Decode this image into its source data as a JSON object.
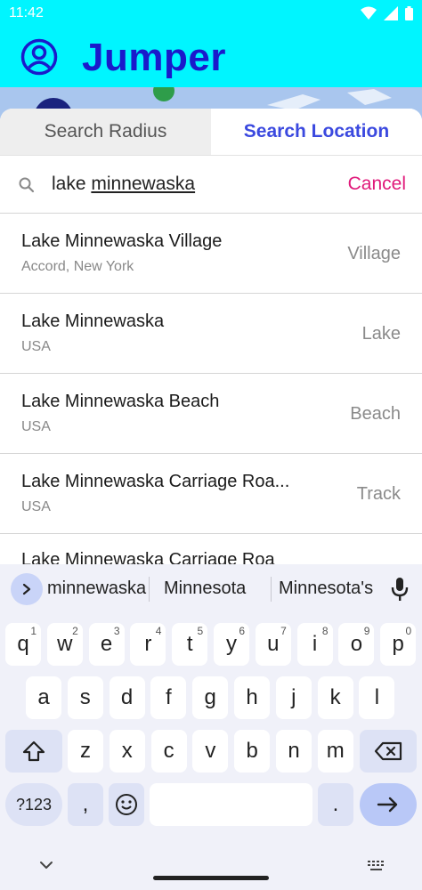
{
  "status": {
    "time": "11:42"
  },
  "app": {
    "title": "Jumper",
    "color_primary": "#00f5ff",
    "color_title": "#1a1acb"
  },
  "tabs": [
    {
      "label": "Search Radius",
      "active": false
    },
    {
      "label": "Search Location",
      "active": true
    }
  ],
  "search": {
    "prefix": "lake ",
    "underlined": "minnewaska",
    "cancel_label": "Cancel"
  },
  "results": [
    {
      "name": "Lake Minnewaska Village",
      "subtitle": "Accord, New York",
      "type": "Village"
    },
    {
      "name": "Lake Minnewaska",
      "subtitle": "USA",
      "type": "Lake"
    },
    {
      "name": "Lake Minnewaska Beach",
      "subtitle": "USA",
      "type": "Beach"
    },
    {
      "name": "Lake Minnewaska Carriage Roa...",
      "subtitle": "USA",
      "type": "Track"
    },
    {
      "name": "Lake Minnewaska Carriage Roa",
      "subtitle": "",
      "type": ""
    }
  ],
  "keyboard": {
    "suggestions": [
      "minnewaska",
      "Minnesota",
      "Minnesota's"
    ],
    "row1": [
      {
        "k": "q",
        "h": "1"
      },
      {
        "k": "w",
        "h": "2"
      },
      {
        "k": "e",
        "h": "3"
      },
      {
        "k": "r",
        "h": "4"
      },
      {
        "k": "t",
        "h": "5"
      },
      {
        "k": "y",
        "h": "6"
      },
      {
        "k": "u",
        "h": "7"
      },
      {
        "k": "i",
        "h": "8"
      },
      {
        "k": "o",
        "h": "9"
      },
      {
        "k": "p",
        "h": "0"
      }
    ],
    "row2": [
      "a",
      "s",
      "d",
      "f",
      "g",
      "h",
      "j",
      "k",
      "l"
    ],
    "row3": [
      "z",
      "x",
      "c",
      "v",
      "b",
      "n",
      "m"
    ],
    "symbols_label": "?123",
    "comma": ",",
    "period": "."
  }
}
